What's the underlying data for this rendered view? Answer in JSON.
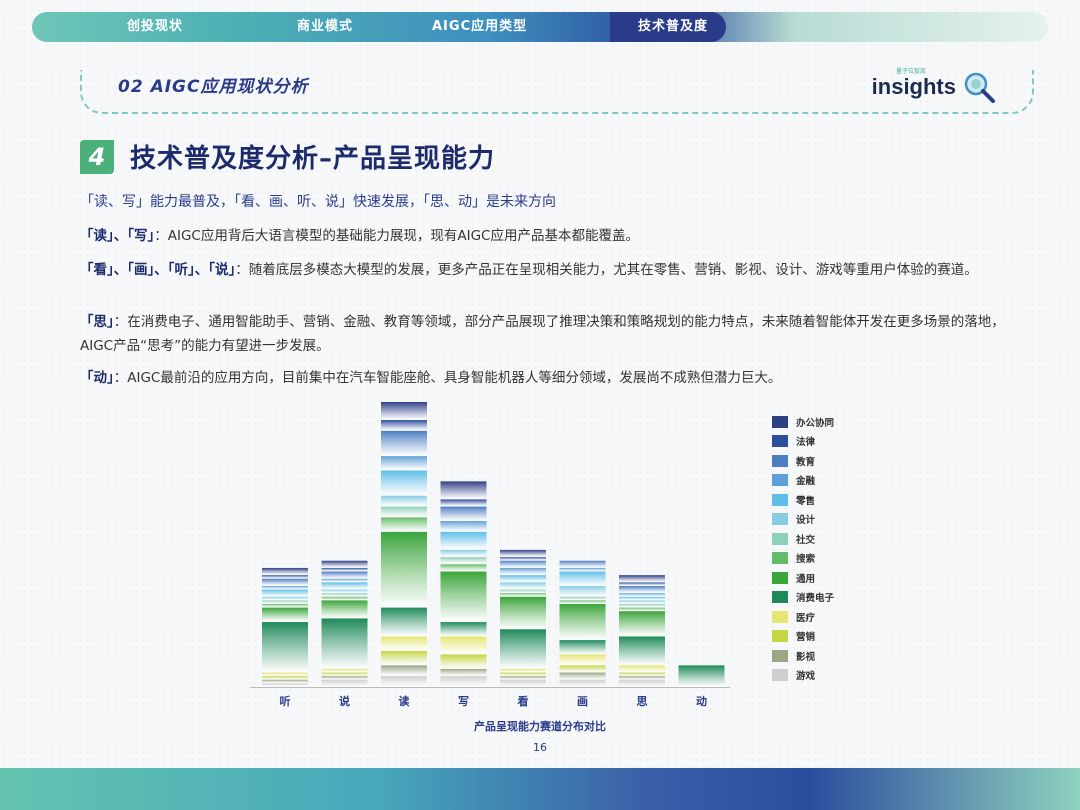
{
  "nav": {
    "tabs": [
      {
        "label": "创投现状",
        "left": 95
      },
      {
        "label": "商业模式",
        "left": 265
      },
      {
        "label": "AIGC应用类型",
        "left": 400
      },
      {
        "label": "技术普及度",
        "active": true
      }
    ]
  },
  "section": {
    "title": "02   AIGC应用现状分析",
    "logo_word": "insights",
    "logo_small": "量子位智库"
  },
  "heading": {
    "number": "4",
    "title": "技术普及度分析–产品呈现能力"
  },
  "subtitle": "「读、写」能力最普及，「看、画、听、说」快速发展，「思、动」是未来方向",
  "paragraphs": [
    {
      "lead": "「读」、「写」",
      "text": "：AIGC应用背后大语言模型的基础能力展现，现有AIGC应用产品基本都能覆盖。"
    },
    {
      "lead": "「看」、「画」、「听」、「说」",
      "text": "：随着底层多模态大模型的发展，更多产品正在呈现相关能力，尤其在零售、营销、影视、设计、游戏等重用户体验的赛道。"
    },
    {
      "lead": "「思」",
      "text": "：在消费电子、通用智能助手、营销、金融、教育等领域，部分产品展现了推理决策和策略规划的能力特点，未来随着智能体开发在更多场景的落地，AIGC产品“思考”的能力有望进一步发展。"
    },
    {
      "lead": "「动」",
      "text": "：AIGC最前沿的应用方向，目前集中在汽车智能座舱、具身智能机器人等细分领域，发展尚不成熟但潜力巨大。"
    }
  ],
  "chart_data": {
    "type": "bar",
    "stacked": true,
    "xlabel": "产品呈现能力赛道分布对比",
    "categories": [
      "听",
      "说",
      "读",
      "写",
      "看",
      "画",
      "思",
      "动"
    ],
    "series": [
      {
        "name": "办公协同",
        "color": "#2f3f86",
        "values": [
          2,
          2,
          5,
          5,
          2,
          0,
          2,
          0
        ]
      },
      {
        "name": "法律",
        "color": "#2e4f9e",
        "values": [
          1,
          1,
          3,
          2,
          1,
          0,
          1,
          0
        ]
      },
      {
        "name": "教育",
        "color": "#4d7ec2",
        "values": [
          2,
          2,
          7,
          4,
          2,
          2,
          2,
          0
        ]
      },
      {
        "name": "金融",
        "color": "#5fa0d6",
        "values": [
          1,
          1,
          4,
          3,
          2,
          1,
          1,
          0
        ]
      },
      {
        "name": "零售",
        "color": "#5fbde8",
        "values": [
          2,
          2,
          7,
          5,
          2,
          4,
          1,
          0
        ]
      },
      {
        "name": "设计",
        "color": "#86cde3",
        "values": [
          1,
          1,
          3,
          2,
          2,
          3,
          1,
          0
        ]
      },
      {
        "name": "社交",
        "color": "#8fd0b8",
        "values": [
          1,
          1,
          3,
          2,
          1,
          1,
          1,
          0
        ]
      },
      {
        "name": "搜索",
        "color": "#66bb6a",
        "values": [
          1,
          1,
          4,
          2,
          1,
          1,
          1,
          0
        ]
      },
      {
        "name": "通用",
        "color": "#3aa53a",
        "values": [
          4,
          5,
          21,
          14,
          9,
          10,
          7,
          0
        ]
      },
      {
        "name": "消费电子",
        "color": "#1e8a5a",
        "values": [
          14,
          14,
          8,
          4,
          11,
          4,
          8,
          6
        ]
      },
      {
        "name": "医疗",
        "color": "#e6e672",
        "values": [
          1,
          1,
          4,
          5,
          1,
          3,
          2,
          0
        ]
      },
      {
        "name": "营销",
        "color": "#c4d644",
        "values": [
          1,
          1,
          4,
          4,
          1,
          2,
          1,
          0
        ]
      },
      {
        "name": "影视",
        "color": "#9aa784",
        "values": [
          1,
          1,
          3,
          2,
          1,
          2,
          1,
          0
        ]
      },
      {
        "name": "游戏",
        "color": "#cfcfcf",
        "values": [
          1,
          2,
          3,
          3,
          2,
          2,
          2,
          0
        ]
      }
    ],
    "legend_position": "right",
    "grid": false
  },
  "page_number": "16"
}
